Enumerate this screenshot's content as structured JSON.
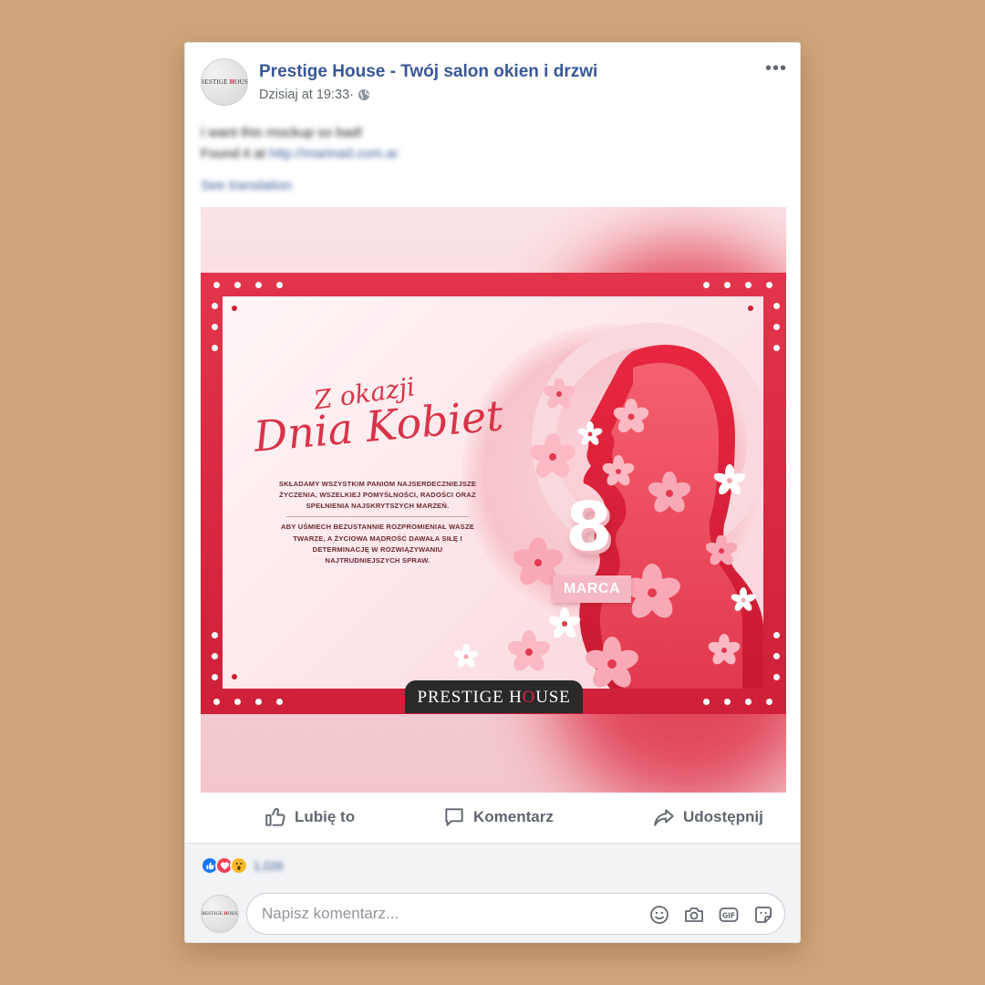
{
  "post": {
    "page_name": "Prestige House - Twój salon okien i drzwi",
    "timestamp": "Dzisiaj at 19:33·",
    "avatar_logo_text": "Prestige House",
    "body_line_1": "I want this mockup so bad!",
    "body_line_2_prefix": "Found it at ",
    "body_link": "http://marinad.com.ar",
    "see_translation": "See translation"
  },
  "image": {
    "headline_small": "Z okazji",
    "headline_large": "Dnia Kobiet",
    "wishes_1": "SKŁADAMY WSZYSTKIM PANIOM NAJSERDECZNIEJSZE ŻYCZENIA, WSZELKIEJ POMYŚLNOŚCI, RADOŚCI ORAZ SPEŁNIENIA NAJSKRYTSZYCH MARZEŃ.",
    "wishes_2": "ABY UŚMIECH BEZUSTANNIE ROZPROMIENIAŁ WASZE TWARZE, A ŻYCIOWA MĄDROŚĆ DAWAŁA SIŁĘ I DETERMINACJĘ W ROZWIĄZYWANIU NAJTRUDNIEJSZYCH SPRAW.",
    "day_number": "8",
    "month": "MARCA",
    "brand_part_1": "Prestige H",
    "brand_part_2": "o",
    "brand_part_3": "use"
  },
  "actions": {
    "like": "Lubię to",
    "comment": "Komentarz",
    "share": "Udostępnij"
  },
  "reactions": {
    "count": "1,026"
  },
  "comment": {
    "placeholder": "Napisz komentarz..."
  },
  "colors": {
    "page_bg": "#cfa47a",
    "accent_red": "#d93349",
    "fb_link_blue": "#385898"
  }
}
